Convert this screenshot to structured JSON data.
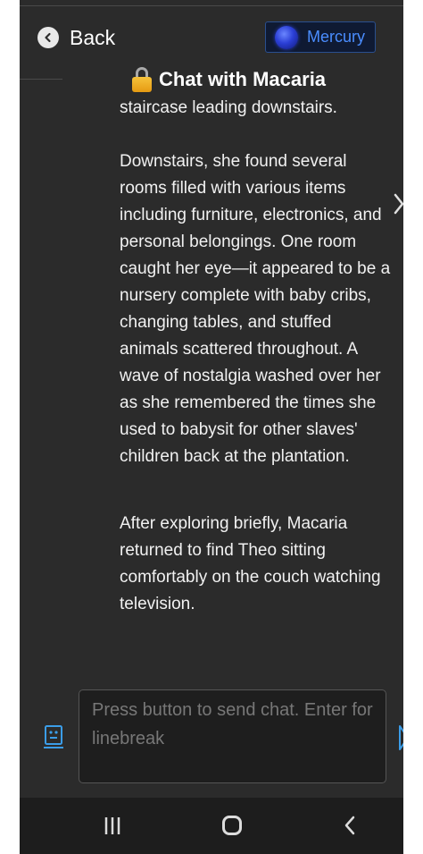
{
  "header": {
    "back_label": "Back",
    "model_label": "Mercury",
    "chat_title": "Chat with Macaria"
  },
  "icons": {
    "back": "chevron-left-circle-icon",
    "model": "planet-icon",
    "title": "lock-icon",
    "next": "chevron-right-icon",
    "composer_left": "robot-face-icon",
    "send": "send-icon"
  },
  "message": {
    "paragraphs": [
      "staircase leading downstairs.",
      "Downstairs, she found several rooms filled with various items including furniture, electronics, and personal belongings. One room caught her eye—it appeared to be a nursery complete with baby cribs, changing tables, and stuffed animals scattered throughout. A wave of nostalgia washed over her as she remembered the times she used to babysit for other slaves' children back at the plantation.",
      "After exploring briefly, Macaria returned to find Theo sitting comfortably on the couch watching television."
    ]
  },
  "composer": {
    "placeholder": "Press button to send chat. Enter for linebreak",
    "value": ""
  },
  "colors": {
    "background": "#2b2b2b",
    "accent": "#4a8dff",
    "text": "#f1f1f1",
    "navbar": "#1d1d1d"
  }
}
